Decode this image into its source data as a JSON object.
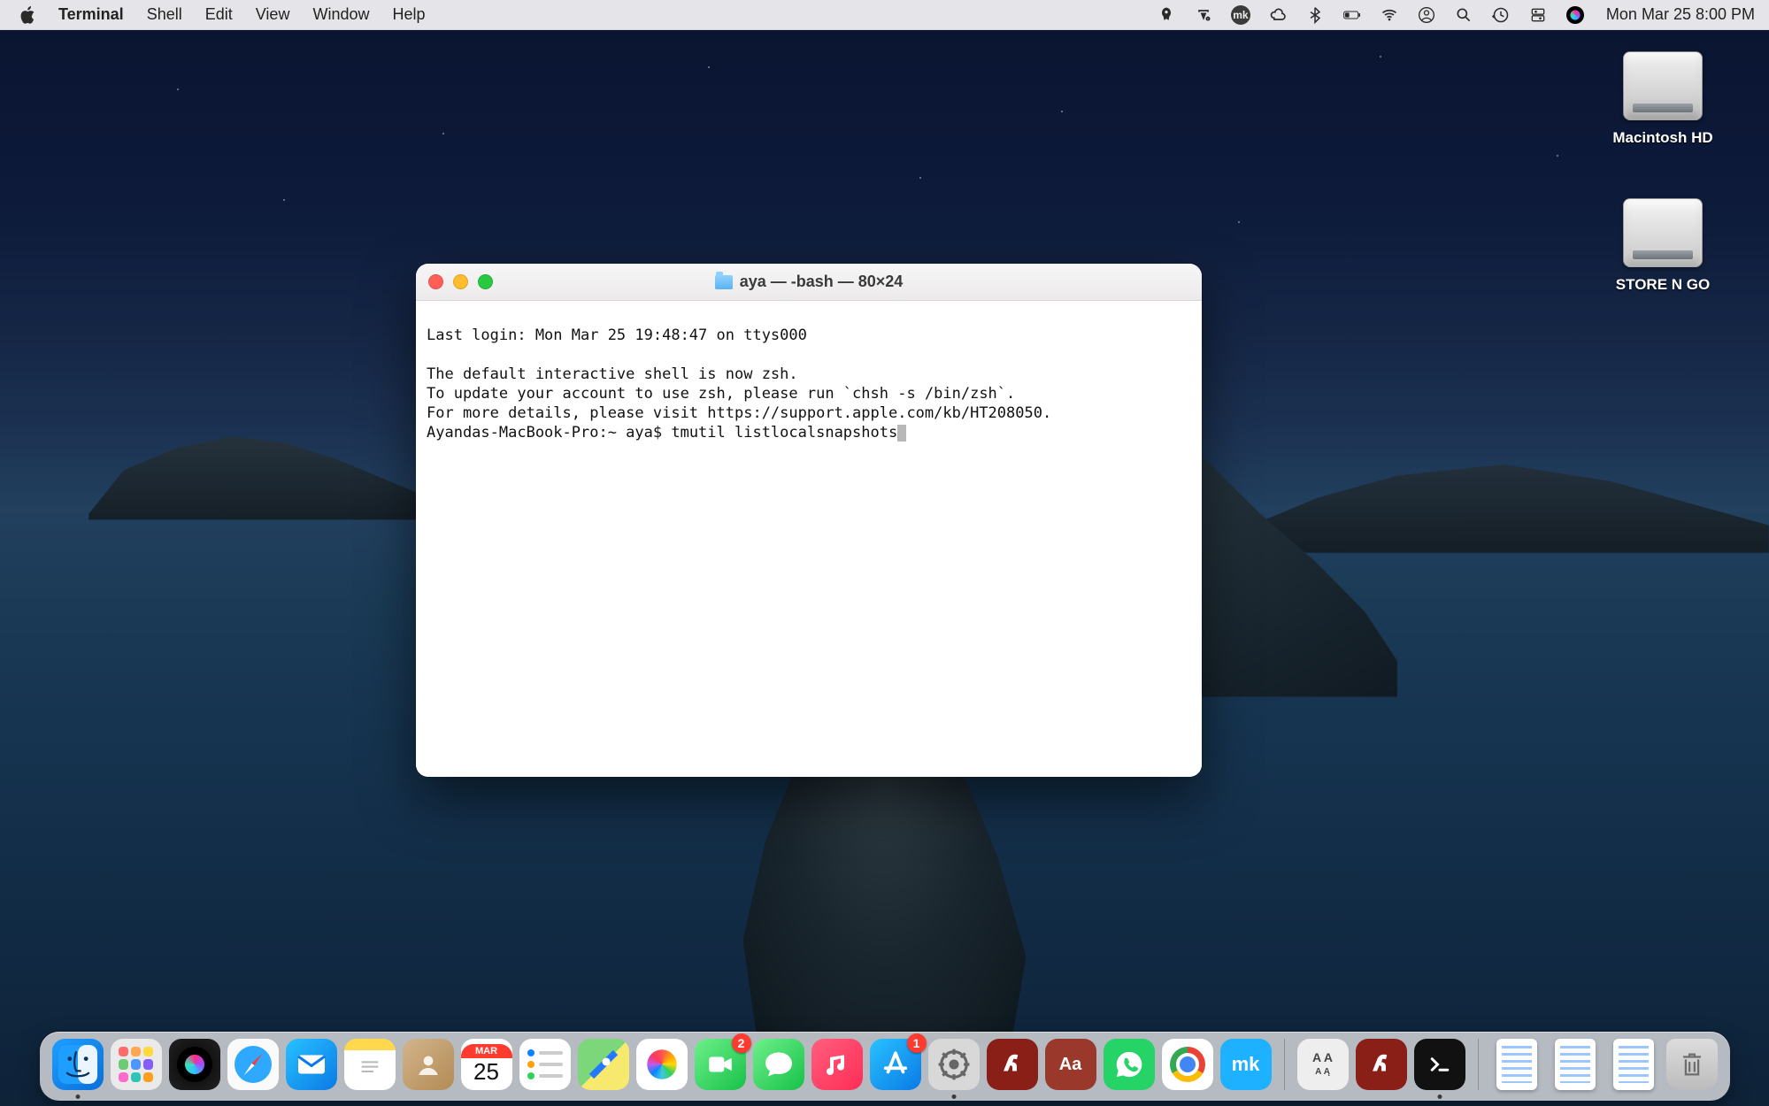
{
  "menubar": {
    "app": "Terminal",
    "items": [
      "Shell",
      "Edit",
      "View",
      "Window",
      "Help"
    ],
    "clock": "Mon Mar 25  8:00 PM",
    "status_icons": [
      "rocket-icon",
      "textreplace-icon",
      "mk-icon",
      "creativecloud-icon",
      "bluetooth-icon",
      "battery-icon",
      "wifi-icon",
      "user-icon",
      "spotlight-icon",
      "timemachine-icon",
      "controlstrip-icon",
      "siri-icon"
    ]
  },
  "desktop": {
    "drives": [
      {
        "name": "Macintosh HD",
        "icon": "internal-drive"
      },
      {
        "name": "STORE N GO",
        "icon": "external-drive"
      }
    ]
  },
  "terminal": {
    "title": "aya — -bash — 80×24",
    "lines": [
      "Last login: Mon Mar 25 19:48:47 on ttys000",
      "",
      "The default interactive shell is now zsh.",
      "To update your account to use zsh, please run `chsh -s /bin/zsh`.",
      "For more details, please visit https://support.apple.com/kb/HT208050."
    ],
    "prompt": "Ayandas-MacBook-Pro:~ aya$ ",
    "command": "tmutil listlocalsnapshots"
  },
  "calendar_tile": {
    "month": "MAR",
    "day": "25"
  },
  "dock": {
    "main": [
      {
        "name": "finder",
        "label": "Finder",
        "running": true
      },
      {
        "name": "launchpad",
        "label": "Launchpad"
      },
      {
        "name": "siri",
        "label": "Siri"
      },
      {
        "name": "safari",
        "label": "Safari"
      },
      {
        "name": "mail",
        "label": "Mail"
      },
      {
        "name": "notes",
        "label": "Notes"
      },
      {
        "name": "contacts",
        "label": "Contacts"
      },
      {
        "name": "calendar",
        "label": "Calendar"
      },
      {
        "name": "reminders",
        "label": "Reminders"
      },
      {
        "name": "maps",
        "label": "Maps"
      },
      {
        "name": "photos",
        "label": "Photos"
      },
      {
        "name": "facetime",
        "label": "FaceTime",
        "badge": "2"
      },
      {
        "name": "messages",
        "label": "Messages"
      },
      {
        "name": "music",
        "label": "Music"
      },
      {
        "name": "appstore",
        "label": "App Store",
        "badge": "1"
      },
      {
        "name": "settings",
        "label": "System Preferences",
        "running": true
      },
      {
        "name": "flash",
        "label": "Adobe Flash Player"
      },
      {
        "name": "dictionary",
        "label": "Dictionary"
      },
      {
        "name": "whatsapp",
        "label": "WhatsApp"
      },
      {
        "name": "chrome",
        "label": "Google Chrome"
      },
      {
        "name": "mk",
        "label": "MK"
      }
    ],
    "recent": [
      {
        "name": "fontbook",
        "label": "Font Book"
      },
      {
        "name": "flash2",
        "label": "Adobe Flash Player"
      },
      {
        "name": "terminal",
        "label": "Terminal",
        "running": true
      }
    ],
    "right": [
      {
        "name": "doc1",
        "label": "Document"
      },
      {
        "name": "doc2",
        "label": "Document"
      },
      {
        "name": "doc3",
        "label": "Document"
      },
      {
        "name": "trash",
        "label": "Trash"
      }
    ]
  }
}
